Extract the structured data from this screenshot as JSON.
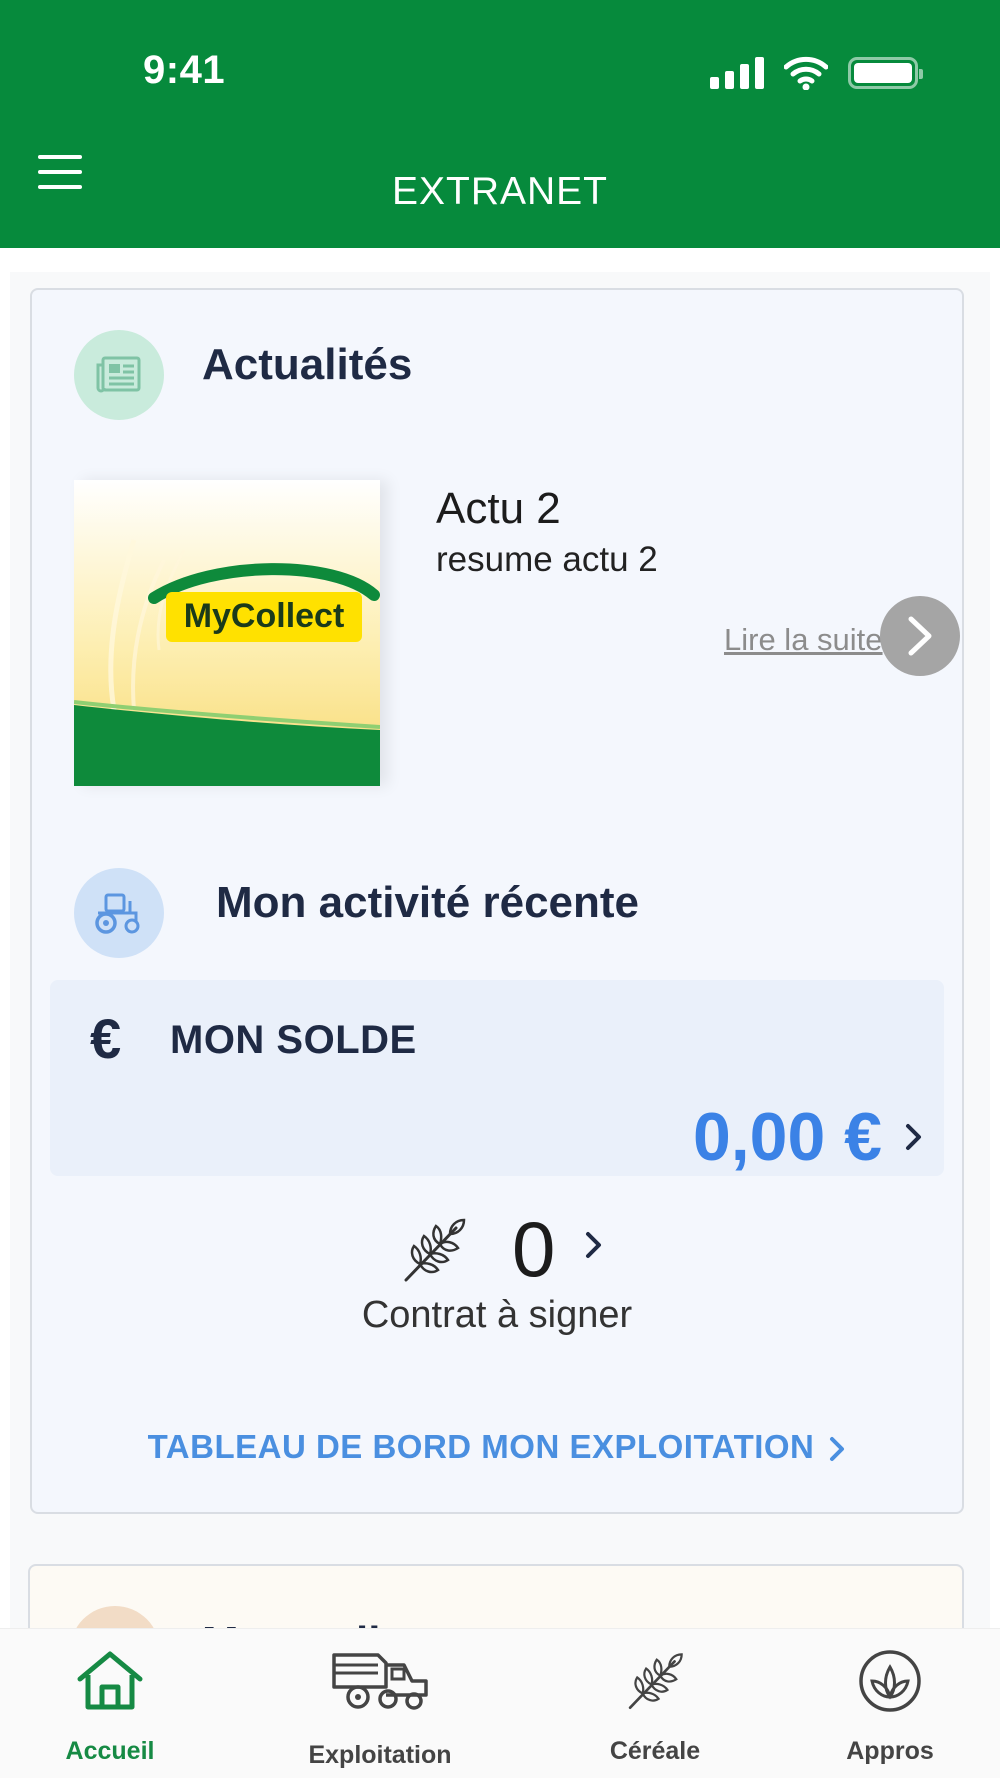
{
  "status_bar": {
    "time": "9:41"
  },
  "header": {
    "title": "EXTRANET"
  },
  "news": {
    "section_title": "Actualités",
    "image_logo_text": "MyCollect",
    "headline": "Actu 2",
    "summary": "resume actu 2",
    "read_more": "Lire la suite"
  },
  "activity": {
    "section_title": "Mon activité récente",
    "balance": {
      "symbol": "€",
      "label": "MON SOLDE",
      "value": "0,00 €"
    },
    "contracts": {
      "count": "0",
      "label": "Contrat à signer"
    },
    "dashboard_link": "TABLEAU DE BORD MON EXPLOITATION"
  },
  "next_card": {
    "title_partial": "Mon collect"
  },
  "bottom_nav": {
    "items": [
      {
        "label": "Accueil",
        "icon": "home-icon",
        "active": true
      },
      {
        "label": "Exploitation",
        "icon": "combine-harvester-icon",
        "active": false
      },
      {
        "label": "Céréale",
        "icon": "wheat-icon",
        "active": false
      },
      {
        "label": "Appros",
        "icon": "leaf-icon",
        "active": false
      }
    ]
  },
  "colors": {
    "primary_green": "#068a3c",
    "accent_blue": "#3b82e6",
    "link_blue": "#4a8fe0",
    "active_nav": "#168a44"
  }
}
